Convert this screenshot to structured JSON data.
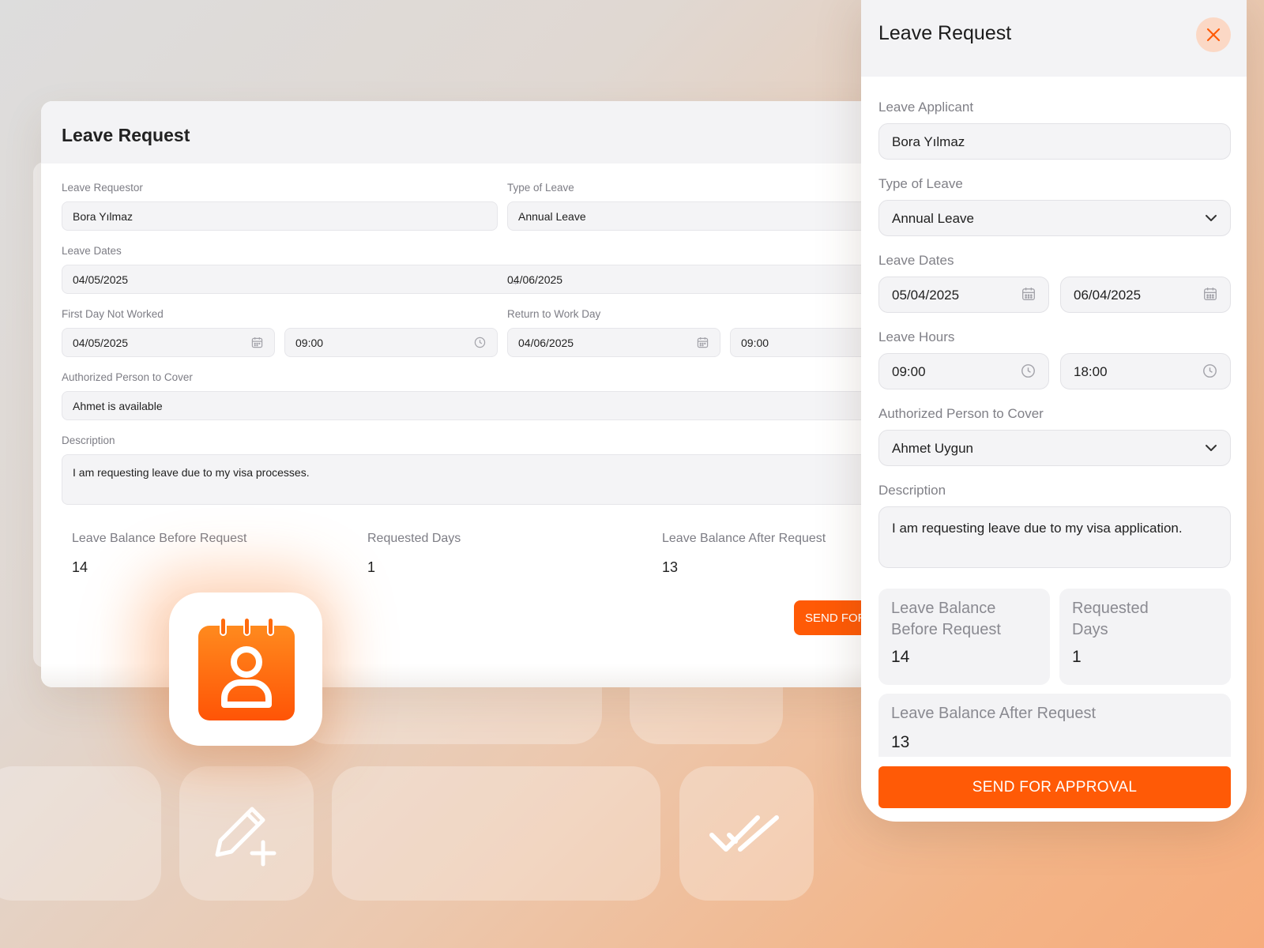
{
  "colors": {
    "accent": "#ff5a06",
    "close_bg": "#fbd8c5"
  },
  "back_form": {
    "title": "Leave Request",
    "requestor_label": "Leave Requestor",
    "requestor_value": "Bora Yılmaz",
    "type_label": "Type of Leave",
    "type_value": "Annual Leave",
    "dates_label": "Leave Dates",
    "date_start": "04/05/2025",
    "date_arrow": "→",
    "date_end": "04/06/2025",
    "first_day_label": "First Day Not Worked",
    "first_day_date": "04/05/2025",
    "first_day_time": "09:00",
    "return_label": "Return to Work Day",
    "return_date": "04/06/2025",
    "return_time": "09:00",
    "cover_label": "Authorized Person to Cover",
    "cover_value": "Ahmet is available",
    "description_label": "Description",
    "description_value": "I am requesting leave due to my visa processes.",
    "balance_before_label": "Leave Balance Before Request",
    "balance_before_value": "14",
    "requested_label": "Requested Days",
    "requested_value": "1",
    "balance_after_label": "Leave Balance After Request",
    "balance_after_value": "13",
    "send_label": "SEND FOR APPROVAL"
  },
  "panel": {
    "title": "Leave Request",
    "applicant_label": "Leave Applicant",
    "applicant_value": "Bora Yılmaz",
    "type_label": "Type of Leave",
    "type_value": "Annual Leave",
    "dates_label": "Leave Dates",
    "date_start": "05/04/2025",
    "date_end": "06/04/2025",
    "hours_label": "Leave Hours",
    "hour_start": "09:00",
    "hour_end": "18:00",
    "cover_label": "Authorized Person to Cover",
    "cover_value": "Ahmet Uygun",
    "description_label": "Description",
    "description_value": "I am requesting leave due to my visa application.",
    "balance_before_label": "Leave Balance Before Request",
    "balance_before_value": "14",
    "requested_label": "Requested Days",
    "requested_value": "1",
    "balance_after_label": "Leave Balance After Request",
    "balance_after_value": "13",
    "send_label": "SEND FOR APPROVAL"
  },
  "icons": {
    "app": "calendar-person-icon",
    "edit": "pencil-plus-icon",
    "done": "double-check-icon",
    "close": "close-icon",
    "calendar": "calendar-icon",
    "clock": "clock-icon",
    "dropdown": "chevron-down-icon"
  }
}
